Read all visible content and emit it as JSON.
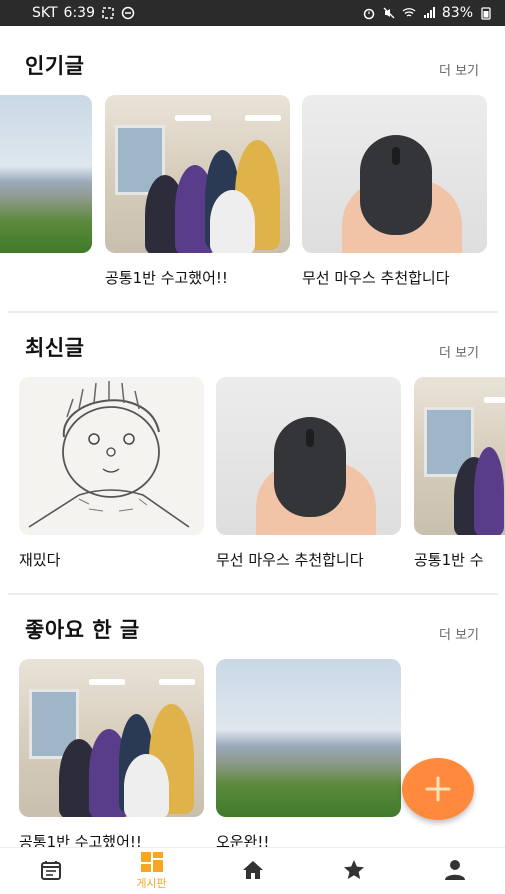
{
  "status": {
    "carrier": "SKT",
    "time": "6:39",
    "battery": "83%"
  },
  "sections": [
    {
      "title": "인기글",
      "more": "더 보기",
      "cards": [
        {
          "caption": "",
          "image": "landscape"
        },
        {
          "caption": "공통1반 수고했어!!",
          "image": "group-photo"
        },
        {
          "caption": "무선 마우스 추천합니다",
          "image": "mouse"
        }
      ]
    },
    {
      "title": "최신글",
      "more": "더 보기",
      "cards": [
        {
          "caption": "재밌다",
          "image": "drawing"
        },
        {
          "caption": "무선 마우스 추천합니다",
          "image": "mouse"
        },
        {
          "caption": "공통1반 수",
          "image": "group-photo"
        }
      ]
    },
    {
      "title": "좋아요 한 글",
      "more": "더 보기",
      "cards": [
        {
          "caption": "공통1반 수고했어!!",
          "image": "group-photo"
        },
        {
          "caption": "오운완!!",
          "image": "landscape"
        }
      ]
    }
  ],
  "fab": {
    "icon": "plus-icon"
  },
  "bottom_nav": [
    {
      "icon": "calendar-icon",
      "label": ""
    },
    {
      "icon": "board-icon",
      "label": "게시판",
      "active": true
    },
    {
      "icon": "home-icon",
      "label": ""
    },
    {
      "icon": "star-icon",
      "label": ""
    },
    {
      "icon": "person-icon",
      "label": ""
    }
  ],
  "colors": {
    "accent": "#f5a623",
    "fab": "#ff8a3d",
    "statusbar": "#2b2b2b"
  }
}
